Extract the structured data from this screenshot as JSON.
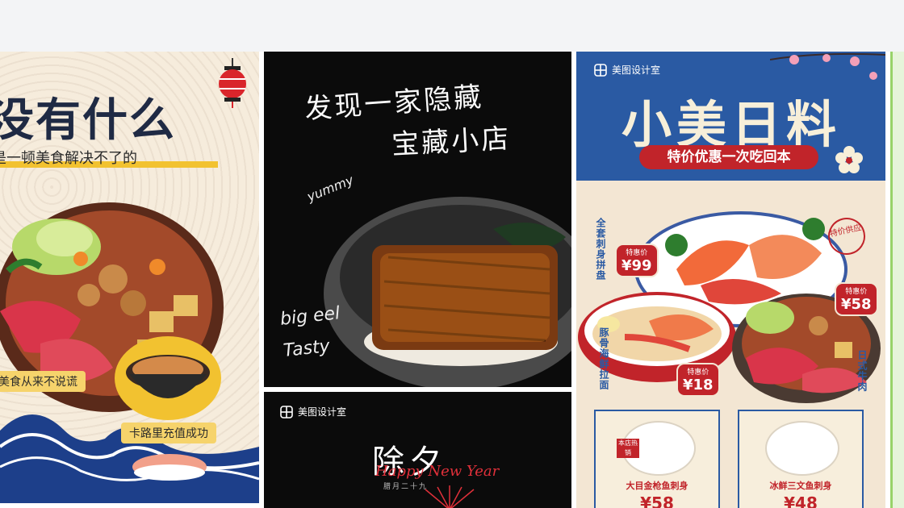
{
  "cards": {
    "hotpot": {
      "title": "没有什么",
      "subtitle": "是一顿美食解决不了的",
      "tag_left": "美食从来不说谎",
      "tag_right": "卡路里充值成功"
    },
    "eel": {
      "line1": "发现一家隐藏",
      "line2": "宝藏小店",
      "yummy": "yummy",
      "big_eel": "big eel",
      "tasty": "Tasty"
    },
    "newyear": {
      "brand": "美图设计室",
      "title": "除夕",
      "english": "Happy New Year",
      "date": "腊月二十九"
    },
    "menu": {
      "brand": "美图设计室",
      "title": "小美日料",
      "ribbon": "特价优惠一次吃回本",
      "sashimi_label": "全套刺身拼盘",
      "sashimi_price_label": "特惠价",
      "sashimi_price": "¥99",
      "ramen_label": "豚骨海鲜拉面",
      "ramen_price_label": "特惠价",
      "ramen_price": "¥18",
      "beef_label": "日式牛肉",
      "beef_price_label": "特惠价",
      "beef_price": "¥58",
      "stamp": "特价供应",
      "item1_badge": "本店热销",
      "item1_name": "大目金枪鱼刺身",
      "item1_price": "¥58",
      "item2_name": "冰鲜三文鱼刺身",
      "item2_price": "¥48"
    }
  },
  "colors": {
    "top_band": "#f3f4f6",
    "menu_blue": "#2a5aa3",
    "menu_red": "#c1242a",
    "cream": "#f3e6d3",
    "hotpot_yellow": "#f2c230"
  }
}
